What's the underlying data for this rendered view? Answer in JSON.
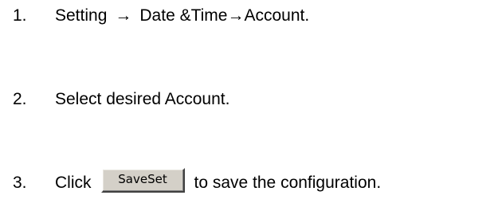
{
  "steps": [
    {
      "number": "1.",
      "parts": [
        "Setting",
        "→",
        "Date &Time",
        "→",
        "Account."
      ]
    },
    {
      "number": "2.",
      "text": "Select desired Account."
    },
    {
      "number": "3.",
      "before": "Click",
      "button_label": "SaveSet",
      "after": "to save the configuration."
    }
  ],
  "colors": {
    "text": "#000000",
    "button_face": "#d4d0c8"
  }
}
